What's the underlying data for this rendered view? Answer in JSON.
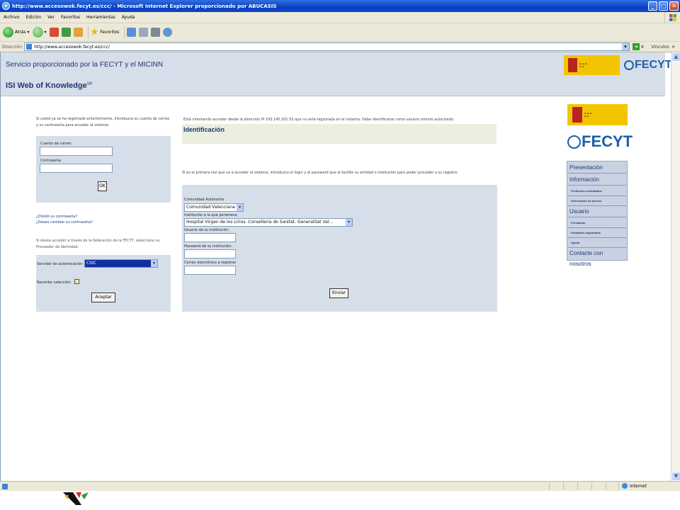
{
  "window": {
    "title": "http://www.accesowok.fecyt.es/ccc/ - Microsoft Internet Explorer proporcionado por ABUCASIS",
    "minimize": "_",
    "maximize": "□",
    "close": "✕"
  },
  "menu": [
    "Archivo",
    "Edición",
    "Ver",
    "Favoritos",
    "Herramientas",
    "Ayuda"
  ],
  "toolbar": {
    "back_label": "Atrás",
    "favorites_label": "Favoritos"
  },
  "address": {
    "label": "Dirección",
    "url": "http://www.accesowok.fecyt.es/ccc/",
    "go_label": "Ir",
    "links_label": "Vínculos"
  },
  "header": {
    "service": "Servicio proporcionado por la FECYT y el MICINN",
    "isi": "ISI Web of Knowledge",
    "isi_sup": "SM",
    "fecyt_logo_text": "FECYT"
  },
  "left": {
    "intro": "Si usted ya se ha registrado anteriormente, introduzca su cuenta de correo y su contraseña para acceder al sistema:",
    "email_label": "Cuenta de correo:",
    "password_label": "Contraseña:",
    "ok_label": "OK",
    "forgot_link": "¿Olvidó su contraseña?",
    "change_link": "¿Desea cambiar su contraseña?",
    "federation_text": "Si desea acceder a través de la federación de la FECYT, seleccione su Proveedor de Identidad:",
    "auth_server_label": "Servidor de autenticación:",
    "auth_server_value": "CSIC",
    "remember_label": "Recordar selección:",
    "accept_label": "Aceptar"
  },
  "center": {
    "notice": "Está intentando acceder desde la dirección IP 193.145.201.52 que no está registrada en el sistema. Debe identificarse como usuario remoto autorizado.",
    "ident_title": "Identificación",
    "first_time_text": "Si es la primera vez que va a acceder al sistema, introduzca el login y el password que le facilite su entidad o institución para poder proceder a su registro:",
    "community_label": "Comunidad Autónoma",
    "community_value": "Comunidad Valenciana",
    "institution_label": "Institución a la que pertenece",
    "institution_value": "Hospital Virgen de los Lirios. Conselleria de Sanitat. Generalitat Val...",
    "user_label": "Usuario de su institución:",
    "pass_label": "Password de su institución:",
    "email_label": "Correo electrónico a registrar",
    "send_label": "Enviar"
  },
  "right_menu": [
    {
      "label": "Presentación",
      "size": "big"
    },
    {
      "label": "Información",
      "size": "big"
    },
    {
      "label": "Productos contratados",
      "size": "small"
    },
    {
      "label": "Información de acceso",
      "size": "small"
    },
    {
      "label": "Usuario",
      "size": "big"
    },
    {
      "label": "Formación",
      "size": "small"
    },
    {
      "label": "Entidades registradas",
      "size": "small"
    },
    {
      "label": "Ayuda",
      "size": "small"
    },
    {
      "label": "Contacte con nosotros",
      "size": "big"
    }
  ],
  "status": {
    "zone": "Internet"
  },
  "colors": {
    "title_blue": "#0a3fbf",
    "band": "#d6deea",
    "brand_blue": "#1e3870",
    "gov_yellow": "#f2c500"
  }
}
